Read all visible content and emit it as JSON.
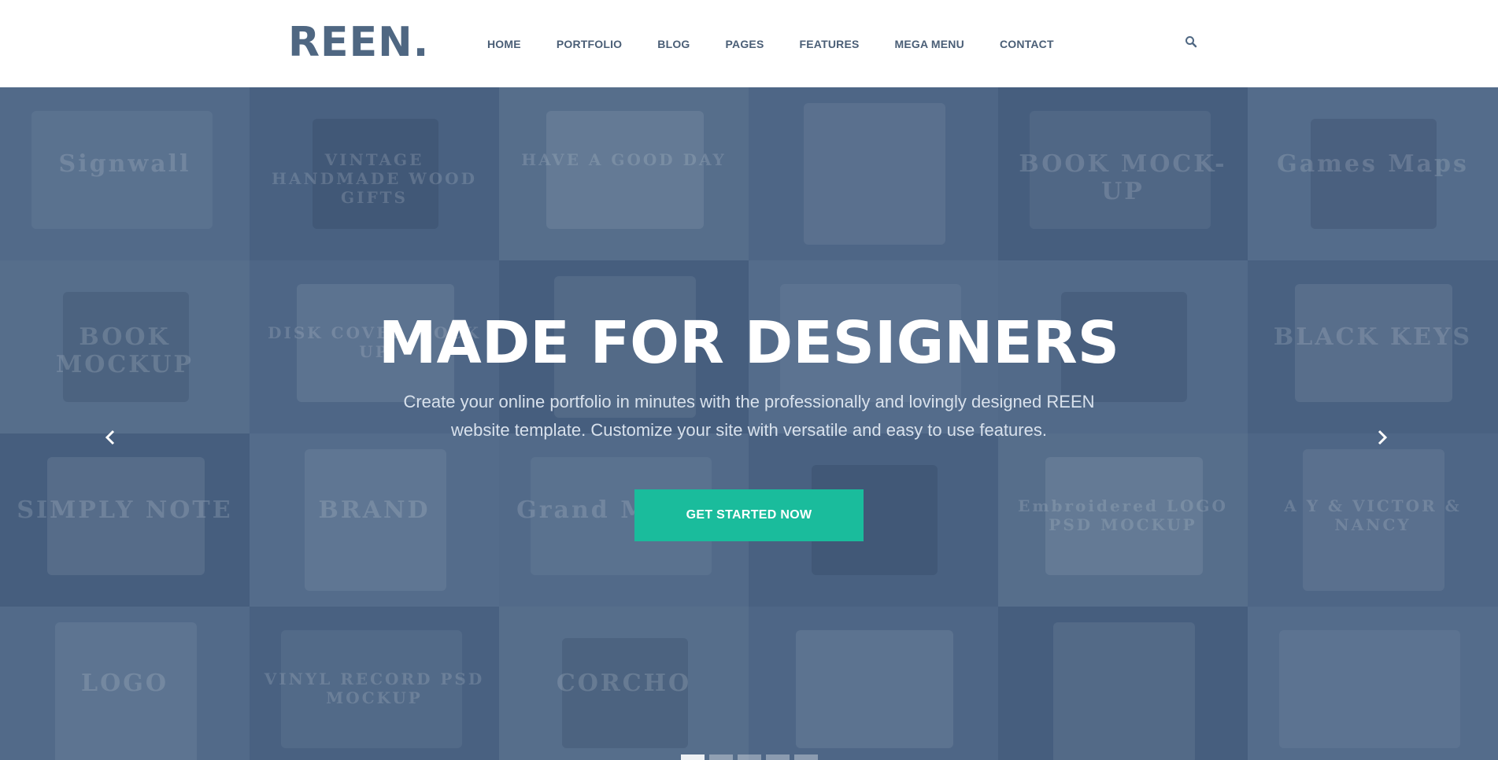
{
  "header": {
    "logo": "REEN.",
    "nav": [
      "HOME",
      "PORTFOLIO",
      "BLOG",
      "PAGES",
      "FEATURES",
      "MEGA MENU",
      "CONTACT"
    ]
  },
  "hero": {
    "title": "MADE FOR DESIGNERS",
    "subtitle_line1": "Create your online portfolio in minutes with the professionally and lovingly designed REEN",
    "subtitle_line2": "website template. Customize your site with versatile and easy to use features.",
    "cta_label": "GET STARTED NOW",
    "slide_count": 5,
    "active_slide": 1,
    "tiles": [
      "Signwall",
      "VINTAGE HANDMADE WOOD GIFTS",
      "HAVE A GOOD DAY",
      "",
      "BOOK MOCK-UP",
      "Games  Maps",
      "BOOK MOCKUP",
      "DISK COVER MOCK UP",
      "",
      "",
      "",
      "BLACK KEYS",
      "SIMPLY NOTE",
      "BRAND",
      "Grand MOTEL",
      "",
      "Embroidered LOGO PSD MOCKUP",
      "A Y & VICTOR & NANCY",
      "LOGO",
      "VINYL RECORD PSD MOCKUP",
      "CORCHO",
      "",
      "",
      ""
    ]
  },
  "colors": {
    "brand": "#4f6782",
    "accent": "#1abc9c",
    "hero_bg": "#4b6382"
  },
  "icons": {
    "search": "search-icon",
    "prev": "chevron-left-icon",
    "next": "chevron-right-icon"
  }
}
